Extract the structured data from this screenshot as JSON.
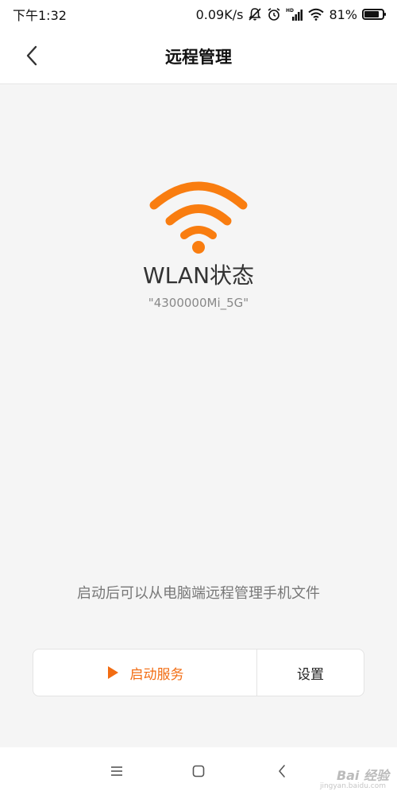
{
  "status_bar": {
    "time": "下午1:32",
    "network_speed": "0.09K/s",
    "battery_percent": "81%",
    "battery_level": 0.81,
    "icons": [
      "mute-icon",
      "alarm-icon",
      "hd-signal-icon",
      "wifi-icon",
      "battery-icon"
    ]
  },
  "header": {
    "title": "远程管理",
    "back_icon": "back-chevron-icon"
  },
  "main": {
    "wlan_status": "WLAN状态",
    "ssid": "\"4300000Mi_5G\"",
    "description": "启动后可以从电脑端远程管理手机文件",
    "wifi_icon_color": "#f97d10"
  },
  "actions": {
    "start_label": "启动服务",
    "settings_label": "设置",
    "accent_color": "#f26c12"
  },
  "nav_bar": {
    "icons": [
      "menu-icon",
      "home-icon",
      "back-icon"
    ]
  },
  "watermark": {
    "text": "Bai 经验",
    "sub": "jingyan.baidu.com"
  }
}
